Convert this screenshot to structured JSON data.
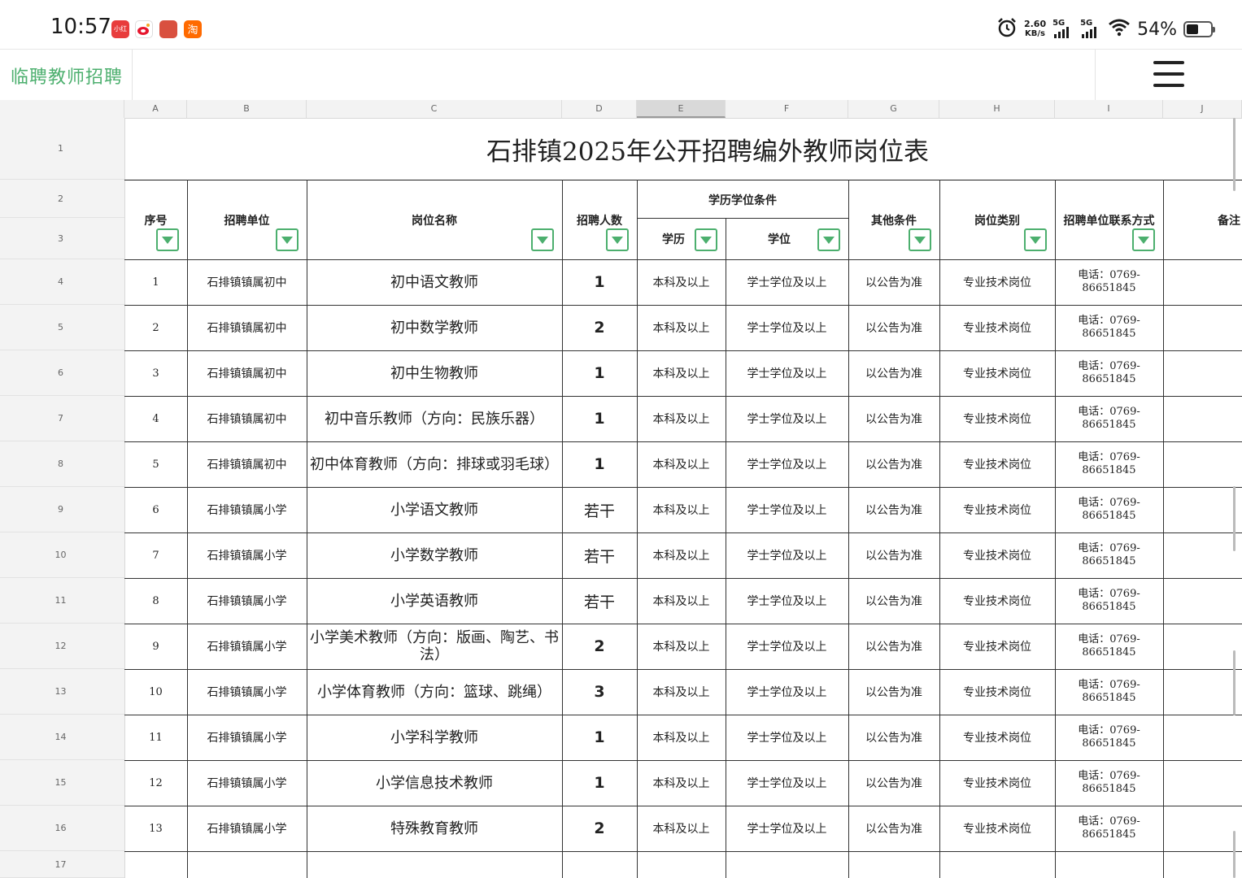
{
  "status_bar": {
    "time": "10:57",
    "app_icons": [
      "小红书",
      "weibo",
      "game",
      "taobao"
    ],
    "net_speed_value": "2.60",
    "net_speed_unit": "KB/s",
    "signal_1": "5G",
    "signal_2": "5G",
    "battery_percent": "54%"
  },
  "header": {
    "title": "临聘教师招聘",
    "menu_icon": "hamburger-menu-icon"
  },
  "columns": [
    "A",
    "B",
    "C",
    "D",
    "E",
    "F",
    "G",
    "H",
    "I",
    "J"
  ],
  "selected_column": "E",
  "row_numbers": [
    "1",
    "2",
    "3",
    "4",
    "5",
    "6",
    "7",
    "8",
    "9",
    "10",
    "11",
    "12",
    "13",
    "14",
    "15",
    "16",
    "17"
  ],
  "sheet": {
    "title": "石排镇2025年公开招聘编外教师岗位表",
    "headers": {
      "index": "序号",
      "unit": "招聘单位",
      "position": "岗位名称",
      "count": "招聘人数",
      "edu_group": "学历学位条件",
      "education": "学历",
      "degree": "学位",
      "other": "其他条件",
      "category": "岗位类别",
      "contact": "招聘单位联系方式",
      "remark": "备注"
    },
    "rows": [
      {
        "no": "1",
        "unit": "石排镇镇属初中",
        "position": "初中语文教师",
        "count": "1",
        "education": "本科及以上",
        "degree": "学士学位及以上",
        "other": "以公告为准",
        "category": "专业技术岗位",
        "contact": "电话：0769-86651845"
      },
      {
        "no": "2",
        "unit": "石排镇镇属初中",
        "position": "初中数学教师",
        "count": "2",
        "education": "本科及以上",
        "degree": "学士学位及以上",
        "other": "以公告为准",
        "category": "专业技术岗位",
        "contact": "电话：0769-86651845"
      },
      {
        "no": "3",
        "unit": "石排镇镇属初中",
        "position": "初中生物教师",
        "count": "1",
        "education": "本科及以上",
        "degree": "学士学位及以上",
        "other": "以公告为准",
        "category": "专业技术岗位",
        "contact": "电话：0769-86651845"
      },
      {
        "no": "4",
        "unit": "石排镇镇属初中",
        "position": "初中音乐教师（方向：民族乐器）",
        "count": "1",
        "education": "本科及以上",
        "degree": "学士学位及以上",
        "other": "以公告为准",
        "category": "专业技术岗位",
        "contact": "电话：0769-86651845"
      },
      {
        "no": "5",
        "unit": "石排镇镇属初中",
        "position": "初中体育教师（方向：排球或羽毛球）",
        "count": "1",
        "education": "本科及以上",
        "degree": "学士学位及以上",
        "other": "以公告为准",
        "category": "专业技术岗位",
        "contact": "电话：0769-86651845"
      },
      {
        "no": "6",
        "unit": "石排镇镇属小学",
        "position": "小学语文教师",
        "count": "若干",
        "education": "本科及以上",
        "degree": "学士学位及以上",
        "other": "以公告为准",
        "category": "专业技术岗位",
        "contact": "电话：0769-86651845"
      },
      {
        "no": "7",
        "unit": "石排镇镇属小学",
        "position": "小学数学教师",
        "count": "若干",
        "education": "本科及以上",
        "degree": "学士学位及以上",
        "other": "以公告为准",
        "category": "专业技术岗位",
        "contact": "电话：0769-86651845"
      },
      {
        "no": "8",
        "unit": "石排镇镇属小学",
        "position": "小学英语教师",
        "count": "若干",
        "education": "本科及以上",
        "degree": "学士学位及以上",
        "other": "以公告为准",
        "category": "专业技术岗位",
        "contact": "电话：0769-86651845"
      },
      {
        "no": "9",
        "unit": "石排镇镇属小学",
        "position": "小学美术教师（方向：版画、陶艺、书法）",
        "count": "2",
        "education": "本科及以上",
        "degree": "学士学位及以上",
        "other": "以公告为准",
        "category": "专业技术岗位",
        "contact": "电话：0769-86651845"
      },
      {
        "no": "10",
        "unit": "石排镇镇属小学",
        "position": "小学体育教师（方向：篮球、跳绳）",
        "count": "3",
        "education": "本科及以上",
        "degree": "学士学位及以上",
        "other": "以公告为准",
        "category": "专业技术岗位",
        "contact": "电话：0769-86651845"
      },
      {
        "no": "11",
        "unit": "石排镇镇属小学",
        "position": "小学科学教师",
        "count": "1",
        "education": "本科及以上",
        "degree": "学士学位及以上",
        "other": "以公告为准",
        "category": "专业技术岗位",
        "contact": "电话：0769-86651845"
      },
      {
        "no": "12",
        "unit": "石排镇镇属小学",
        "position": "小学信息技术教师",
        "count": "1",
        "education": "本科及以上",
        "degree": "学士学位及以上",
        "other": "以公告为准",
        "category": "专业技术岗位",
        "contact": "电话：0769-86651845"
      },
      {
        "no": "13",
        "unit": "石排镇镇属小学",
        "position": "特殊教育教师",
        "count": "2",
        "education": "本科及以上",
        "degree": "学士学位及以上",
        "other": "以公告为准",
        "category": "专业技术岗位",
        "contact": "电话：0769-86651845"
      }
    ]
  },
  "colors": {
    "accent_green": "#4caf6e",
    "grid_line": "#333333",
    "header_bg": "#f3f3f3"
  }
}
